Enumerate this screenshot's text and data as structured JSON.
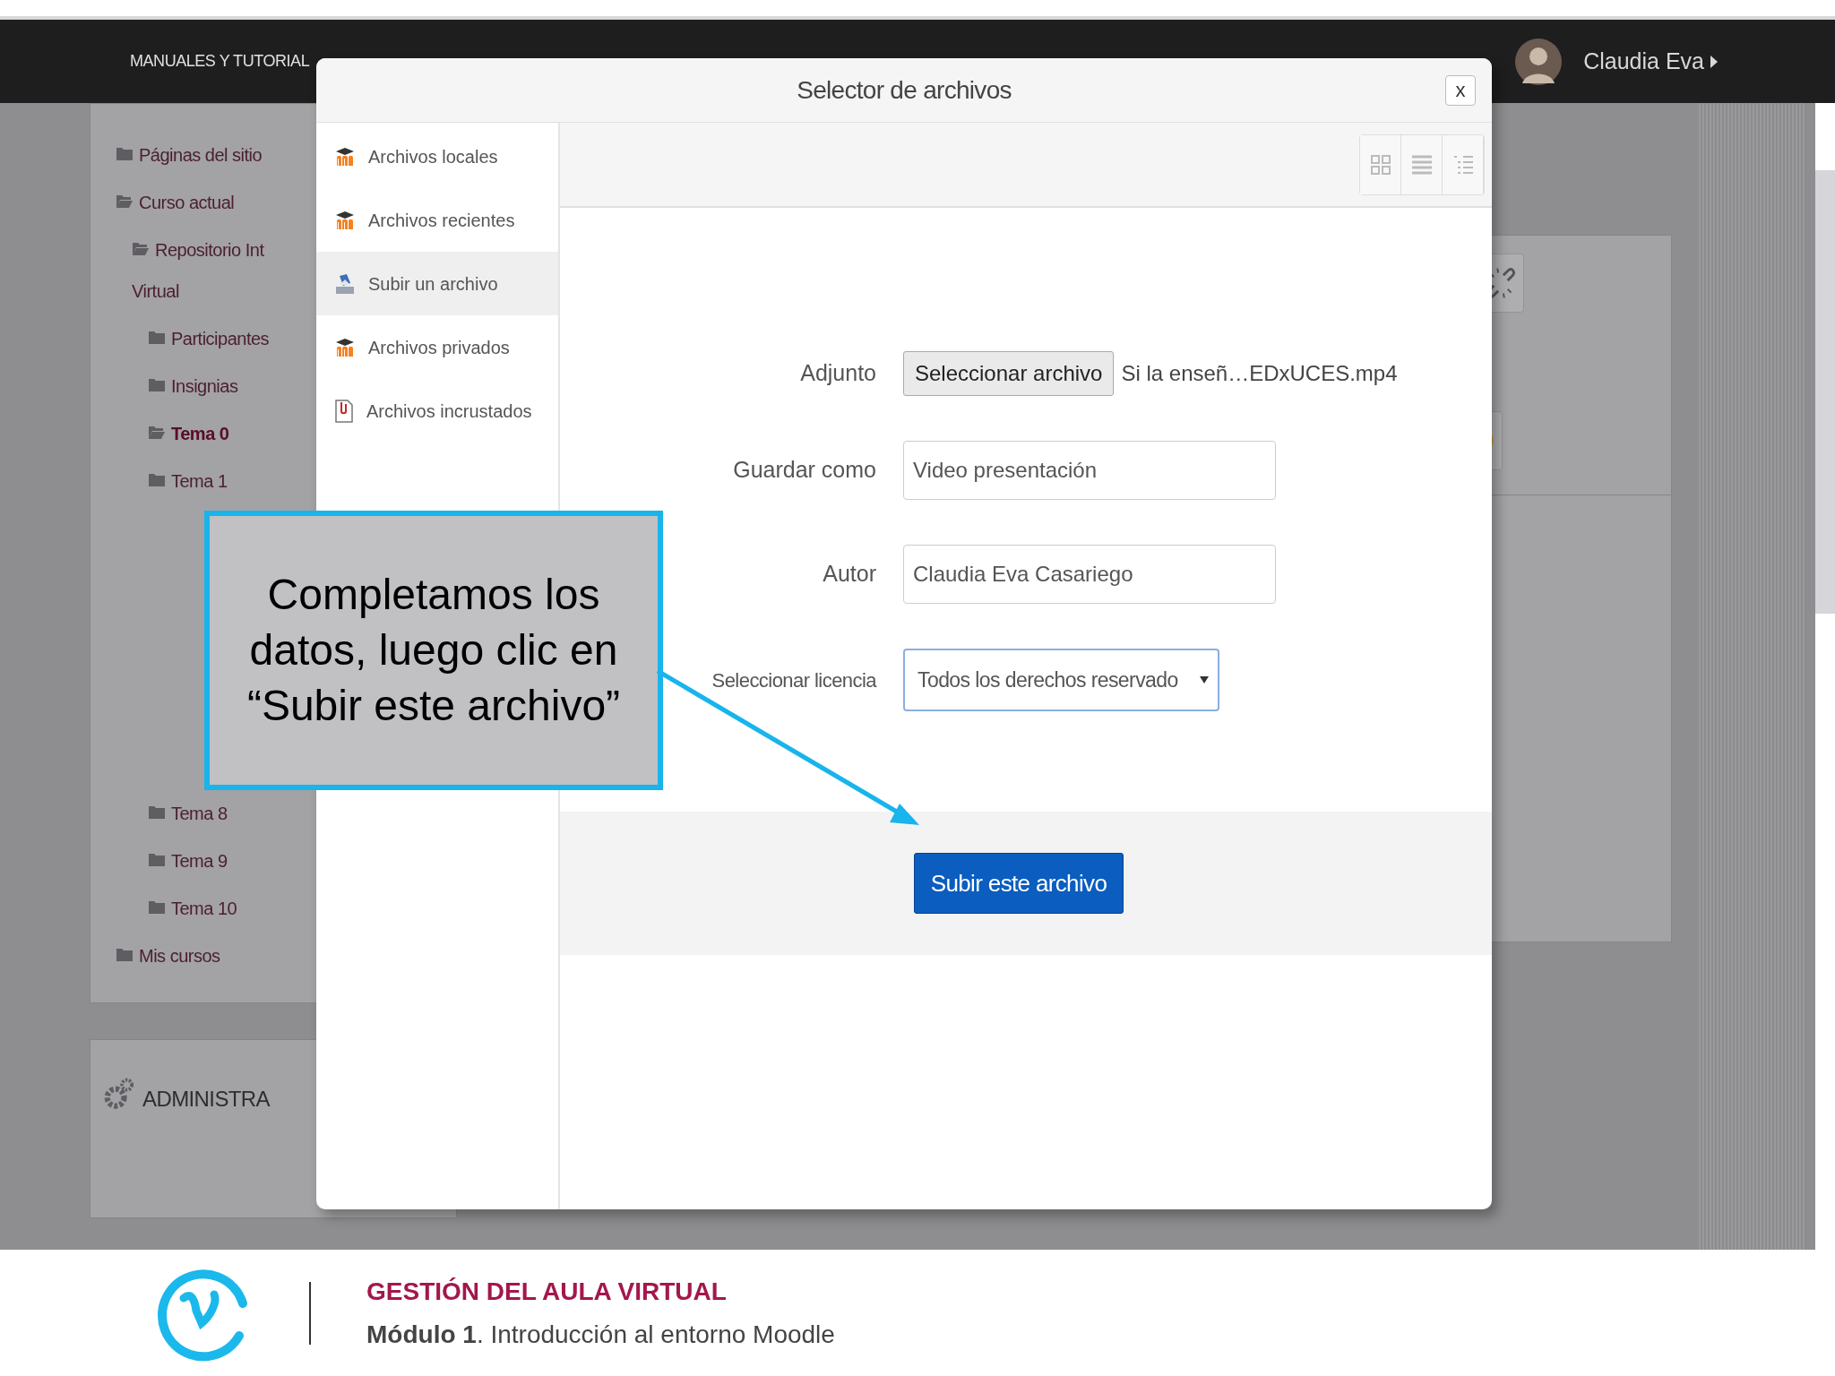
{
  "navbar": {
    "menu": "MANUALES Y TUTORIAL",
    "user": "Claudia Eva"
  },
  "sidebar": {
    "items": [
      {
        "label_lines": [
          "Páginas del sitio"
        ],
        "selected": false,
        "expanded": false
      },
      {
        "label_lines": [
          "Curso actual"
        ],
        "selected": false,
        "expanded": true,
        "children": [
          {
            "label_lines": [
              "Repositorio Int",
              "Virtual"
            ],
            "selected": false,
            "expanded": true,
            "children": [
              {
                "label_lines": [
                  "Participantes"
                ],
                "selected": false,
                "expanded": false
              },
              {
                "label_lines": [
                  "Insignias"
                ],
                "selected": false,
                "expanded": false
              },
              {
                "label_lines": [
                  "Tema 0"
                ],
                "selected": true,
                "expanded": true
              },
              {
                "label_lines": [
                  "Tema 1"
                ],
                "selected": false,
                "expanded": false
              },
              {
                "label_lines": [
                  "Tema 8"
                ],
                "selected": false,
                "expanded": false
              },
              {
                "label_lines": [
                  "Tema 9"
                ],
                "selected": false,
                "expanded": false
              },
              {
                "label_lines": [
                  "Tema 10"
                ],
                "selected": false,
                "expanded": false
              }
            ]
          }
        ]
      },
      {
        "label_lines": [
          "Mis cursos"
        ],
        "selected": false,
        "expanded": false
      }
    ],
    "admin_block": "ADMINISTRA"
  },
  "dialog": {
    "title": "Selector de archivos",
    "close": "x",
    "repositories": [
      {
        "label": "Archivos locales",
        "kind": "moodle",
        "selected": false
      },
      {
        "label": "Archivos recientes",
        "kind": "moodle",
        "selected": false
      },
      {
        "label": "Subir un archivo",
        "kind": "upload",
        "selected": true
      },
      {
        "label": "Archivos privados",
        "kind": "moodle",
        "selected": false
      },
      {
        "label": "Archivos incrustados",
        "kind": "embedded",
        "selected": false
      }
    ],
    "view_buttons": [
      {
        "kind": "icons",
        "selected": false
      },
      {
        "kind": "list",
        "selected": false
      },
      {
        "kind": "tree",
        "selected": false
      }
    ],
    "form": {
      "attachment_label": "Adjunto",
      "choose_button": "Seleccionar archivo",
      "file_name": "Si la enseñ…EDxUCES.mp4",
      "save_as_label": "Guardar como",
      "save_as_value": "Video presentación",
      "author_label": "Autor",
      "author_value": "Claudia Eva Casariego",
      "license_label": "Seleccionar licencia",
      "license_value": "Todos los derechos reservado"
    },
    "upload_button": "Subir este archivo"
  },
  "callout": {
    "text": "Completamos los datos, luego clic en “Subir este archivo”"
  },
  "footer": {
    "title": "GESTIÓN DEL AULA VIRTUAL",
    "subtitle": "**Módulo 1**. Introducción al entorno Moodle"
  }
}
